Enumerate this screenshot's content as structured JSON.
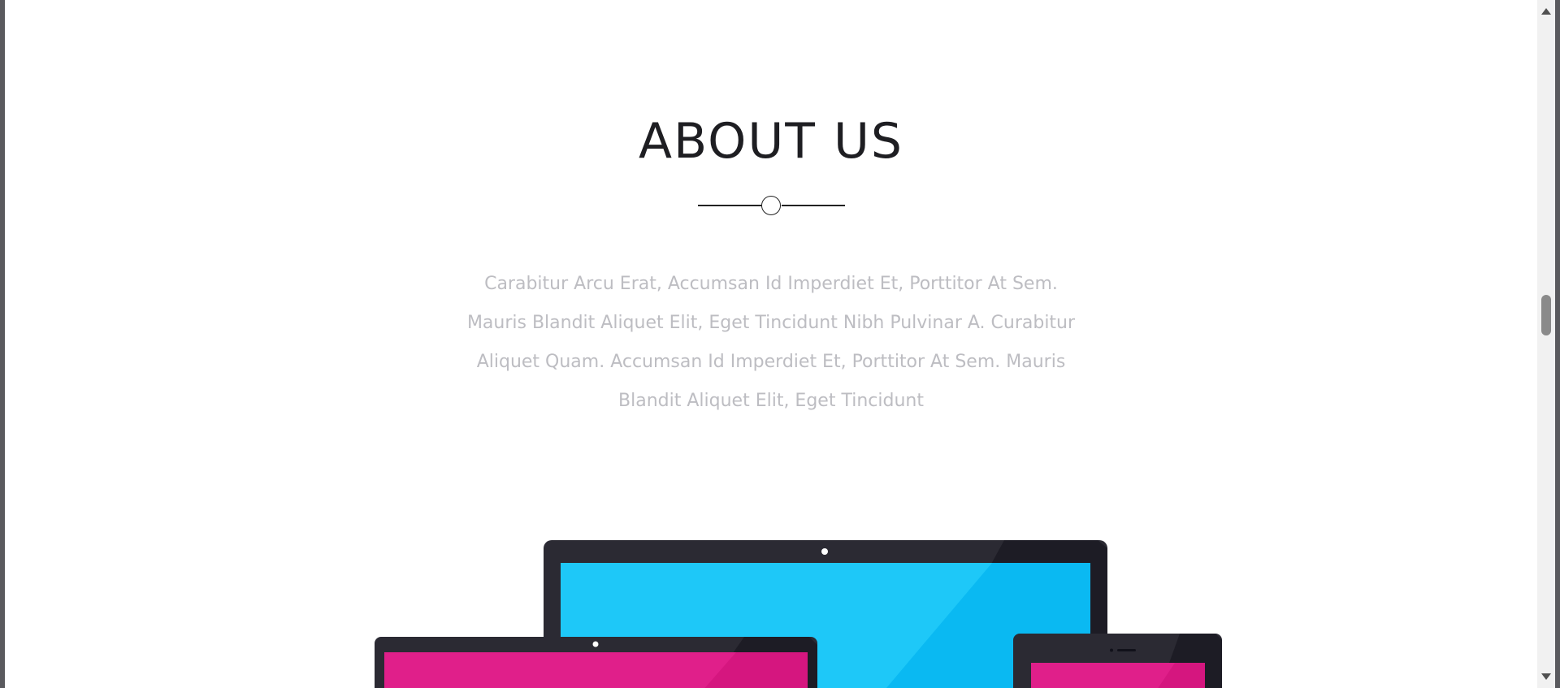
{
  "about": {
    "title": "ABOUT US",
    "paragraph": "Carabitur Arcu Erat, Accumsan Id Imperdiet Et, Porttitor At Sem. Mauris Blandit Aliquet Elit, Eget Tincidunt Nibh Pulvinar A. Curabitur Aliquet Quam. Accumsan Id Imperdiet Et, Porttitor At Sem. Mauris Blandit Aliquet Elit, Eget Tincidunt"
  },
  "illustration": {
    "screen_colors": {
      "laptop_screen": "#1ec8f8",
      "side_screens": "#e01f8a",
      "device_frame": "#2b2a33"
    }
  },
  "scrollbar": {
    "up_icon": "scroll-up-arrow",
    "down_icon": "scroll-down-arrow"
  }
}
